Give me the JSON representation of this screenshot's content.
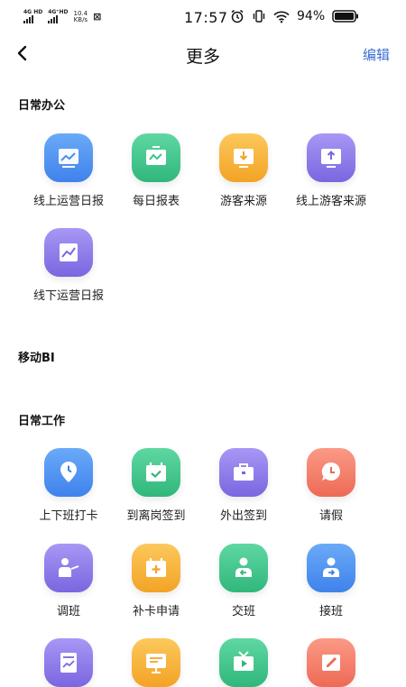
{
  "status_bar": {
    "sim1": "4G HD",
    "sim2": "4G⁺HD",
    "speed_value": "10.4",
    "speed_unit": "KB/s",
    "time": "17:57",
    "battery": "94%"
  },
  "header": {
    "title": "更多",
    "edit_label": "编辑"
  },
  "colors": {
    "accent": "#3b6fd4",
    "blue": "#4a8ff0",
    "green": "#3cc48a",
    "orange": "#f7b23b",
    "purple": "#8c7bea",
    "red": "#f27a68"
  },
  "sections": {
    "daily_office": {
      "title": "日常办公",
      "items": [
        {
          "label": "线上运营日报",
          "icon": "report-chart-icon",
          "color": "blue"
        },
        {
          "label": "每日报表",
          "icon": "trend-board-icon",
          "color": "green"
        },
        {
          "label": "游客来源",
          "icon": "download-monitor-icon",
          "color": "orange"
        },
        {
          "label": "线上游客来源",
          "icon": "upload-monitor-icon",
          "color": "purple"
        },
        {
          "label": "线下运营日报",
          "icon": "line-chart-icon",
          "color": "purple"
        }
      ]
    },
    "mobile_bi": {
      "title": "移动BI"
    },
    "daily_work": {
      "title": "日常工作",
      "items": [
        {
          "label": "上下班打卡",
          "icon": "location-clock-icon",
          "color": "blue"
        },
        {
          "label": "到离岗签到",
          "icon": "calendar-check-icon",
          "color": "green"
        },
        {
          "label": "外出签到",
          "icon": "briefcase-icon",
          "color": "purple"
        },
        {
          "label": "请假",
          "icon": "clock-bubble-icon",
          "color": "red"
        },
        {
          "label": "调班",
          "icon": "person-presenting-icon",
          "color": "purple"
        },
        {
          "label": "补卡申请",
          "icon": "add-card-icon",
          "color": "orange"
        },
        {
          "label": "交班",
          "icon": "handover-person-icon",
          "color": "green"
        },
        {
          "label": "接班",
          "icon": "takeover-person-icon",
          "color": "blue"
        },
        {
          "label": "",
          "icon": "document-chart-icon",
          "color": "purple"
        },
        {
          "label": "",
          "icon": "presentation-board-icon",
          "color": "orange"
        },
        {
          "label": "",
          "icon": "tv-play-icon",
          "color": "green"
        },
        {
          "label": "",
          "icon": "edit-note-icon",
          "color": "red"
        }
      ]
    }
  }
}
